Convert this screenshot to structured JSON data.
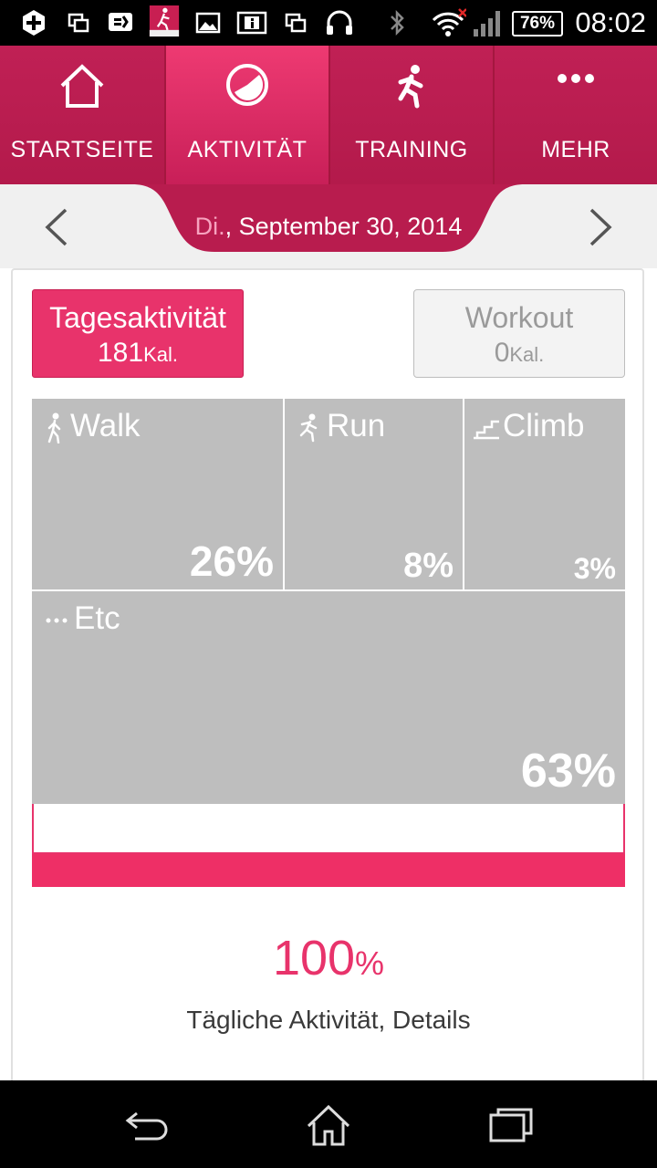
{
  "status_bar": {
    "time": "08:02",
    "battery": "76%",
    "icons": [
      "add-icon",
      "screen-copy-icon",
      "chat-icon",
      "lg-fitness-app-icon",
      "image-icon",
      "info-icon",
      "screen-copy-icon",
      "headphones-icon",
      "bluetooth-icon",
      "wifi-icon",
      "signal-icon",
      "battery-icon"
    ]
  },
  "topnav": {
    "tabs": [
      {
        "label": "STARTSEITE",
        "icon": "home-icon"
      },
      {
        "label": "AKTIVITÄT",
        "icon": "activity-chart-icon",
        "active": true
      },
      {
        "label": "TRAINING",
        "icon": "runner-icon"
      },
      {
        "label": "MEHR",
        "icon": "more-dots-icon"
      }
    ]
  },
  "date_header": {
    "weekday": "Di.",
    "rest": ", September 30, 2014"
  },
  "toggle": {
    "daily": {
      "title": "Tagesaktivität",
      "value": "181",
      "unit": "Kal."
    },
    "workout": {
      "title": "Workout",
      "value": "0",
      "unit": "Kal."
    }
  },
  "breakdown": [
    {
      "label": "Walk",
      "pct": "26%",
      "icon": "walk-icon"
    },
    {
      "label": "Run",
      "pct": "8%",
      "icon": "run-icon"
    },
    {
      "label": "Climb",
      "pct": "3%",
      "icon": "stairs-icon"
    },
    {
      "label": "Etc",
      "pct": "63%",
      "icon": "dots-icon"
    }
  ],
  "progress_fraction": 1.0,
  "total": {
    "value": "100",
    "unit": "%"
  },
  "details_link": "Tägliche Aktivität, Details",
  "colors": {
    "brand": "#c01f52",
    "accent": "#e8336b",
    "tile": "#bebebe"
  }
}
